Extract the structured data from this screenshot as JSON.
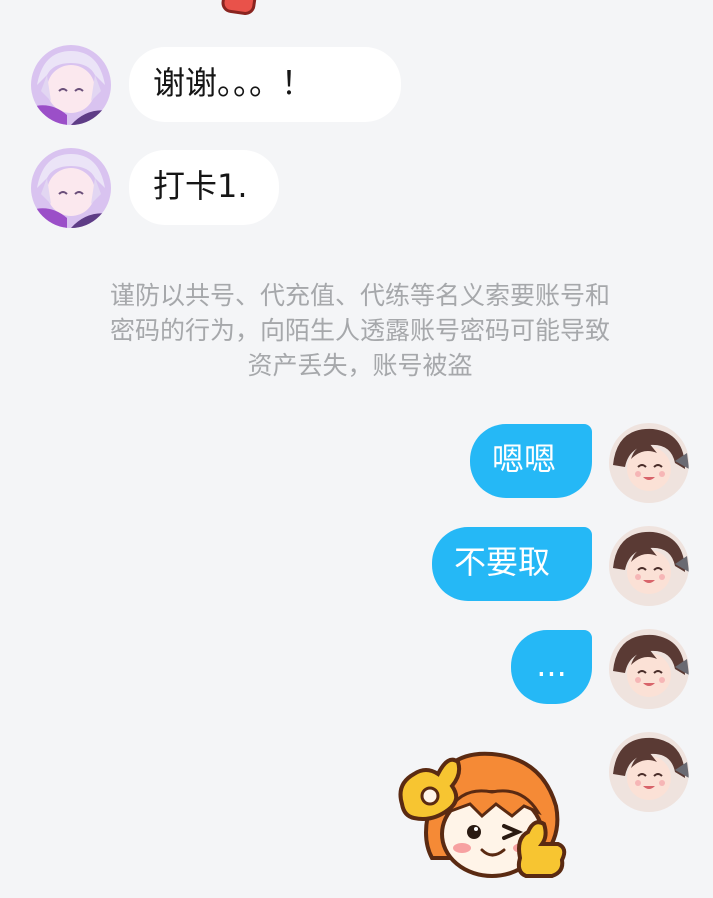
{
  "messages": [
    {
      "side": "left",
      "text": "谢谢。。。！",
      "avatar": "purple-hair-anime-avatar"
    },
    {
      "side": "left",
      "text": "打卡1.",
      "avatar": "purple-hair-anime-avatar"
    },
    {
      "side": "right",
      "text": "嗯嗯",
      "avatar": "brown-hair-anime-avatar"
    },
    {
      "side": "right",
      "text": "不要取",
      "avatar": "brown-hair-anime-avatar"
    },
    {
      "side": "right",
      "text": "...",
      "avatar": "brown-hair-anime-avatar"
    },
    {
      "side": "right",
      "sticker": "orange-hair-character-sticker",
      "avatar": "brown-hair-anime-avatar"
    }
  ],
  "system_notice": {
    "line1": "谨防以共号、代充值、代练等名义索要账号和",
    "line2": "密码的行为，向陌生人透露账号密码可能导致",
    "line3": "资产丢失，账号被盗"
  },
  "colors": {
    "background": "#f4f5f7",
    "incoming_bubble": "#ffffff",
    "outgoing_bubble": "#25b8f6",
    "notice_text": "#a6a8ab"
  }
}
